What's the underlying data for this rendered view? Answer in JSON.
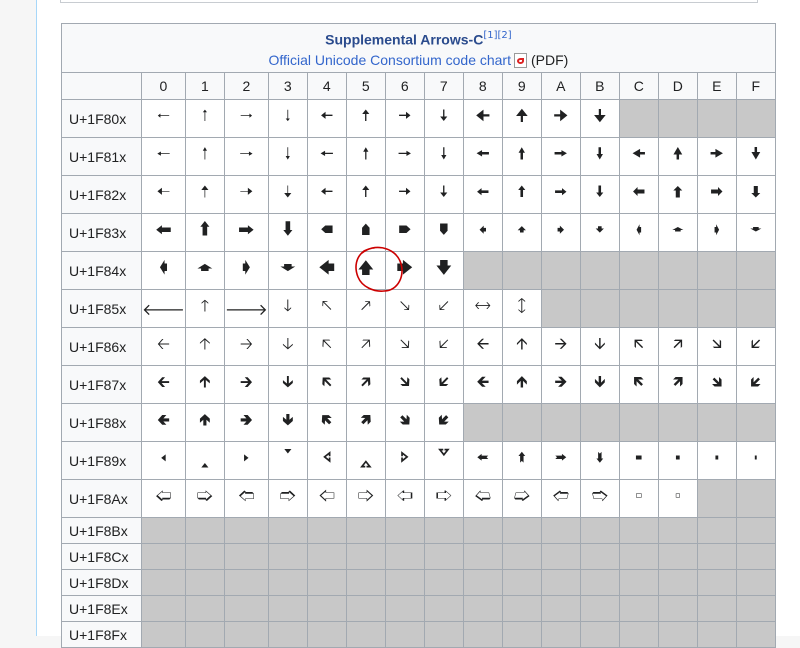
{
  "block": {
    "title": "Supplemental Arrows-C",
    "refs": "[1][2]",
    "chart_link": "Official Unicode Consortium code chart",
    "pdf_label": "(PDF)"
  },
  "columns": [
    "0",
    "1",
    "2",
    "3",
    "4",
    "5",
    "6",
    "7",
    "8",
    "9",
    "A",
    "B",
    "C",
    "D",
    "E",
    "F"
  ],
  "rows": [
    {
      "label": "U+1F80x",
      "cells": [
        "🠀",
        "🠁",
        "🠂",
        "🠃",
        "🠄",
        "🠅",
        "🠆",
        "🠇",
        "🠈",
        "🠉",
        "🠊",
        "🠋",
        "",
        "",
        "",
        ""
      ]
    },
    {
      "label": "U+1F81x",
      "cells": [
        "🠐",
        "🠑",
        "🠒",
        "🠓",
        "🠔",
        "🠕",
        "🠖",
        "🠗",
        "🠘",
        "🠙",
        "🠚",
        "🠛",
        "🠜",
        "🠝",
        "🠞",
        "🠟"
      ]
    },
    {
      "label": "U+1F82x",
      "cells": [
        "🠠",
        "🠡",
        "🠢",
        "🠣",
        "🠤",
        "🠥",
        "🠦",
        "🠧",
        "🠨",
        "🠩",
        "🠪",
        "🠫",
        "🠬",
        "🠭",
        "🠮",
        "🠯"
      ]
    },
    {
      "label": "U+1F83x",
      "cells": [
        "🠰",
        "🠱",
        "🠲",
        "🠳",
        "🠴",
        "🠵",
        "🠶",
        "🠷",
        "🠸",
        "🠹",
        "🠺",
        "🠻",
        "🠼",
        "🠽",
        "🠾",
        "🠿"
      ]
    },
    {
      "label": "U+1F84x",
      "cells": [
        "🡀",
        "🡁",
        "🡂",
        "🡃",
        "🡄",
        "🡅",
        "🡆",
        "🡇",
        "",
        "",
        "",
        "",
        "",
        "",
        "",
        ""
      ]
    },
    {
      "label": "U+1F85x",
      "cells": [
        "🡐",
        "🡑",
        "🡒",
        "🡓",
        "🡔",
        "🡕",
        "🡖",
        "🡗",
        "🡘",
        "🡙",
        "",
        "",
        "",
        "",
        "",
        ""
      ]
    },
    {
      "label": "U+1F86x",
      "cells": [
        "🡠",
        "🡡",
        "🡢",
        "🡣",
        "🡤",
        "🡥",
        "🡦",
        "🡧",
        "🡨",
        "🡩",
        "🡪",
        "🡫",
        "🡬",
        "🡭",
        "🡮",
        "🡯"
      ]
    },
    {
      "label": "U+1F87x",
      "cells": [
        "🡰",
        "🡱",
        "🡲",
        "🡳",
        "🡴",
        "🡵",
        "🡶",
        "🡷",
        "🡸",
        "🡹",
        "🡺",
        "🡻",
        "🡼",
        "🡽",
        "🡾",
        "🡿"
      ]
    },
    {
      "label": "U+1F88x",
      "cells": [
        "🢀",
        "🢁",
        "🢂",
        "🢃",
        "🢄",
        "🢅",
        "🢆",
        "🢇",
        "",
        "",
        "",
        "",
        "",
        "",
        "",
        ""
      ]
    },
    {
      "label": "U+1F89x",
      "cells": [
        "🢐",
        "🢑",
        "🢒",
        "🢓",
        "🢔",
        "🢕",
        "🢖",
        "🢗",
        "🢘",
        "🢙",
        "🢚",
        "🢛",
        "🢜",
        "🢝",
        "🢞",
        "🢟"
      ]
    },
    {
      "label": "U+1F8Ax",
      "cells": [
        "🢠",
        "🢡",
        "🢢",
        "🢣",
        "🢤",
        "🢥",
        "🢦",
        "🢧",
        "🢨",
        "🢩",
        "🢪",
        "🢫",
        "🢬",
        "🢭",
        "",
        ""
      ]
    },
    {
      "label": "U+1F8Bx",
      "cells": [
        "",
        "",
        "",
        "",
        "",
        "",
        "",
        "",
        "",
        "",
        "",
        "",
        "",
        "",
        "",
        ""
      ]
    },
    {
      "label": "U+1F8Cx",
      "cells": [
        "",
        "",
        "",
        "",
        "",
        "",
        "",
        "",
        "",
        "",
        "",
        "",
        "",
        "",
        "",
        ""
      ]
    },
    {
      "label": "U+1F8Dx",
      "cells": [
        "",
        "",
        "",
        "",
        "",
        "",
        "",
        "",
        "",
        "",
        "",
        "",
        "",
        "",
        "",
        ""
      ]
    },
    {
      "label": "U+1F8Ex",
      "cells": [
        "",
        "",
        "",
        "",
        "",
        "",
        "",
        "",
        "",
        "",
        "",
        "",
        "",
        "",
        "",
        ""
      ]
    },
    {
      "label": "U+1F8Fx",
      "cells": [
        "",
        "",
        "",
        "",
        "",
        "",
        "",
        "",
        "",
        "",
        "",
        "",
        "",
        "",
        "",
        ""
      ]
    }
  ],
  "colors": {
    "title": "#2a4b8d",
    "link": "#3366cc",
    "border": "#a2a9b1",
    "empty_cell": "#c8c8c8",
    "annotation": "#cc0000"
  }
}
